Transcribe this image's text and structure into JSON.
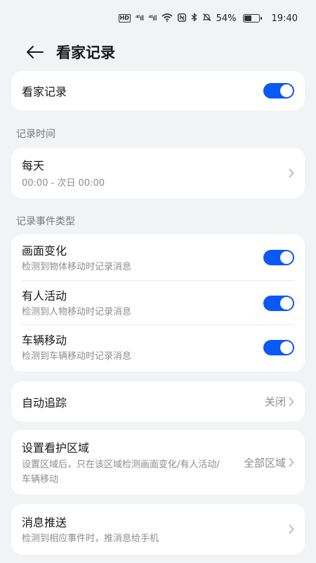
{
  "status_bar": {
    "hd_tag": "HD",
    "sim1": "⁴⁶ıll",
    "sim2": "⁴⁶ıll",
    "battery_percent": "54%",
    "battery_level": 0.54,
    "time": "19:40",
    "icons": [
      "wifi-icon",
      "nfc-icon",
      "bluetooth-icon",
      "mute-icon",
      "battery-icon"
    ]
  },
  "header": {
    "title": "看家记录"
  },
  "main_toggle": {
    "label": "看家记录",
    "on": true
  },
  "record_time": {
    "section_label": "记录时间",
    "title": "每天",
    "range": "00:00 - 次日 00:00"
  },
  "event_types": {
    "section_label": "记录事件类型",
    "items": [
      {
        "title": "画面变化",
        "subtitle": "检测到物体移动时记录消息",
        "on": true
      },
      {
        "title": "有人活动",
        "subtitle": "检测到人物移动时记录消息",
        "on": true
      },
      {
        "title": "车辆移动",
        "subtitle": "检测到车辆移动时记录消息",
        "on": true
      }
    ]
  },
  "auto_track": {
    "label": "自动追踪",
    "value": "关闭"
  },
  "guard_zone": {
    "title": "设置看护区域",
    "subtitle": "设置区域后，只在该区域检测画面变化/有人活动/车辆移动",
    "value": "全部区域"
  },
  "push": {
    "title": "消息推送",
    "subtitle": "检测到相应事件时，推消息给手机"
  },
  "colors": {
    "accent": "#0a59f7",
    "background": "#f1f3f5",
    "card": "#ffffff"
  }
}
